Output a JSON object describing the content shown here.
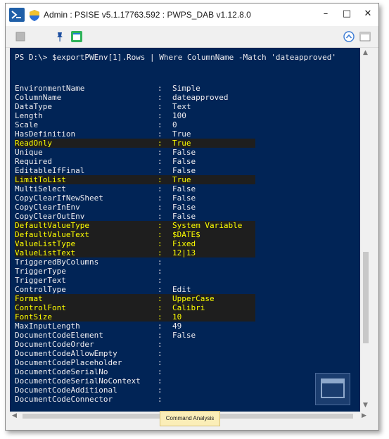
{
  "window": {
    "title": "Admin : PSISE v5.1.17763.592 : PWPS_DAB v1.12.8.0",
    "min_label": "–",
    "max_label": "□",
    "close_label": "✕"
  },
  "console": {
    "prompt": "PS D:\\> $exportPWEnv[1].Rows | Where ColumnName -Match 'dateapproved'",
    "properties": [
      {
        "name": "EnvironmentName",
        "value": "Simple",
        "highlight": false
      },
      {
        "name": "ColumnName",
        "value": "dateapproved",
        "highlight": false
      },
      {
        "name": "DataType",
        "value": "Text",
        "highlight": false
      },
      {
        "name": "Length",
        "value": "100",
        "highlight": false
      },
      {
        "name": "Scale",
        "value": "0",
        "highlight": false
      },
      {
        "name": "HasDefinition",
        "value": "True",
        "highlight": false
      },
      {
        "name": "ReadOnly",
        "value": "True",
        "highlight": true
      },
      {
        "name": "Unique",
        "value": "False",
        "highlight": false
      },
      {
        "name": "Required",
        "value": "False",
        "highlight": false
      },
      {
        "name": "EditableIfFinal",
        "value": "False",
        "highlight": false
      },
      {
        "name": "LimitToList",
        "value": "True",
        "highlight": true
      },
      {
        "name": "MultiSelect",
        "value": "False",
        "highlight": false
      },
      {
        "name": "CopyClearIfNewSheet",
        "value": "False",
        "highlight": false
      },
      {
        "name": "CopyClearInEnv",
        "value": "False",
        "highlight": false
      },
      {
        "name": "CopyClearOutEnv",
        "value": "False",
        "highlight": false
      },
      {
        "name": "DefaultValueType",
        "value": "System Variable",
        "highlight": true
      },
      {
        "name": "DefaultValueText",
        "value": "$DATE$",
        "highlight": true
      },
      {
        "name": "ValueListType",
        "value": "Fixed",
        "highlight": true
      },
      {
        "name": "ValueListText",
        "value": "12|13",
        "highlight": true
      },
      {
        "name": "TriggeredByColumns",
        "value": "",
        "highlight": false
      },
      {
        "name": "TriggerType",
        "value": "",
        "highlight": false
      },
      {
        "name": "TriggerText",
        "value": "",
        "highlight": false
      },
      {
        "name": "ControlType",
        "value": "Edit",
        "highlight": false
      },
      {
        "name": "Format",
        "value": "UpperCase",
        "highlight": true
      },
      {
        "name": "ControlFont",
        "value": "Calibri",
        "highlight": true
      },
      {
        "name": "FontSize",
        "value": "10",
        "highlight": true
      },
      {
        "name": "MaxInputLength",
        "value": "49",
        "highlight": false
      },
      {
        "name": "DocumentCodeElement",
        "value": "False",
        "highlight": false
      },
      {
        "name": "DocumentCodeOrder",
        "value": "",
        "highlight": false
      },
      {
        "name": "DocumentCodeAllowEmpty",
        "value": "",
        "highlight": false
      },
      {
        "name": "DocumentCodePlaceholder",
        "value": "",
        "highlight": false
      },
      {
        "name": "DocumentCodeSerialNo",
        "value": "",
        "highlight": false
      },
      {
        "name": "DocumentCodeSerialNoContext",
        "value": "",
        "highlight": false
      },
      {
        "name": "DocumentCodeAdditional",
        "value": "",
        "highlight": false
      },
      {
        "name": "DocumentCodeConnector",
        "value": "",
        "highlight": false
      }
    ]
  },
  "bottom": {
    "command_tab": "Command Analysis"
  },
  "colors": {
    "console_bg": "#012456",
    "console_fg": "#eeedf0",
    "highlight_bg": "#1e1e1e",
    "highlight_fg": "#ffff00"
  }
}
